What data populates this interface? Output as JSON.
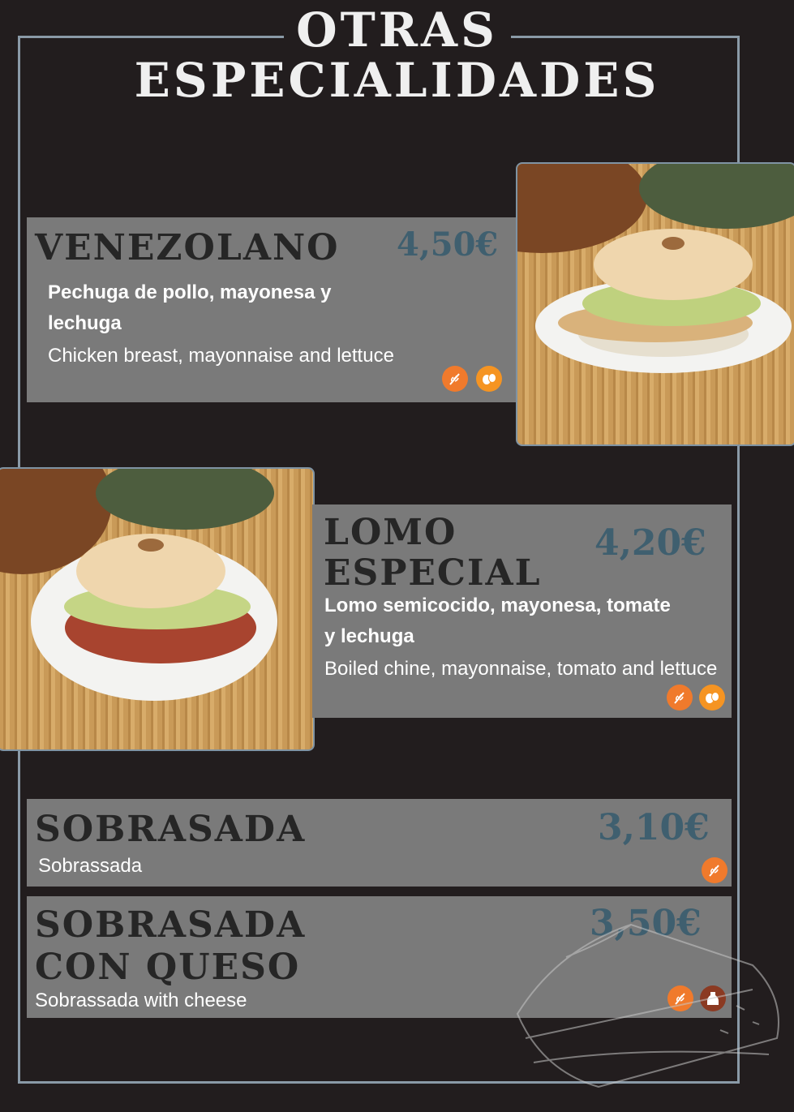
{
  "title": {
    "line1": "OTRAS",
    "line2": "ESPECIALIDADES"
  },
  "colors": {
    "background": "#221d1e",
    "card": "#7a7a7a",
    "price": "#3f5f6f",
    "frame": "#8a9aa7",
    "gluten_icon": "#f07a2c",
    "egg_icon": "#f59422",
    "dairy_icon": "#8b3a22"
  },
  "items": [
    {
      "name": "VENEZOLANO",
      "price": "4,50€",
      "desc_es_1": "Pechuga de pollo, mayonesa y",
      "desc_es_2": "lechuga",
      "desc_en": "Chicken breast, mayonnaise and lettuce",
      "allergens": [
        "gluten-icon",
        "egg-icon"
      ]
    },
    {
      "name_1": "LOMO",
      "name_2": "ESPECIAL",
      "price": "4,20€",
      "desc_es_1": "Lomo semicocido, mayonesa, tomate",
      "desc_es_2": "y lechuga",
      "desc_en": "Boiled chine, mayonnaise, tomato and lettuce",
      "allergens": [
        "gluten-icon",
        "egg-icon"
      ]
    },
    {
      "name": "SOBRASADA",
      "price": "3,10€",
      "desc_en": "Sobrassada",
      "allergens": [
        "gluten-icon"
      ]
    },
    {
      "name_1": "SOBRASADA",
      "name_2": "CON QUESO",
      "price": "3,50€",
      "desc_en": "Sobrassada with cheese",
      "allergens": [
        "gluten-icon",
        "dairy-icon"
      ]
    }
  ]
}
